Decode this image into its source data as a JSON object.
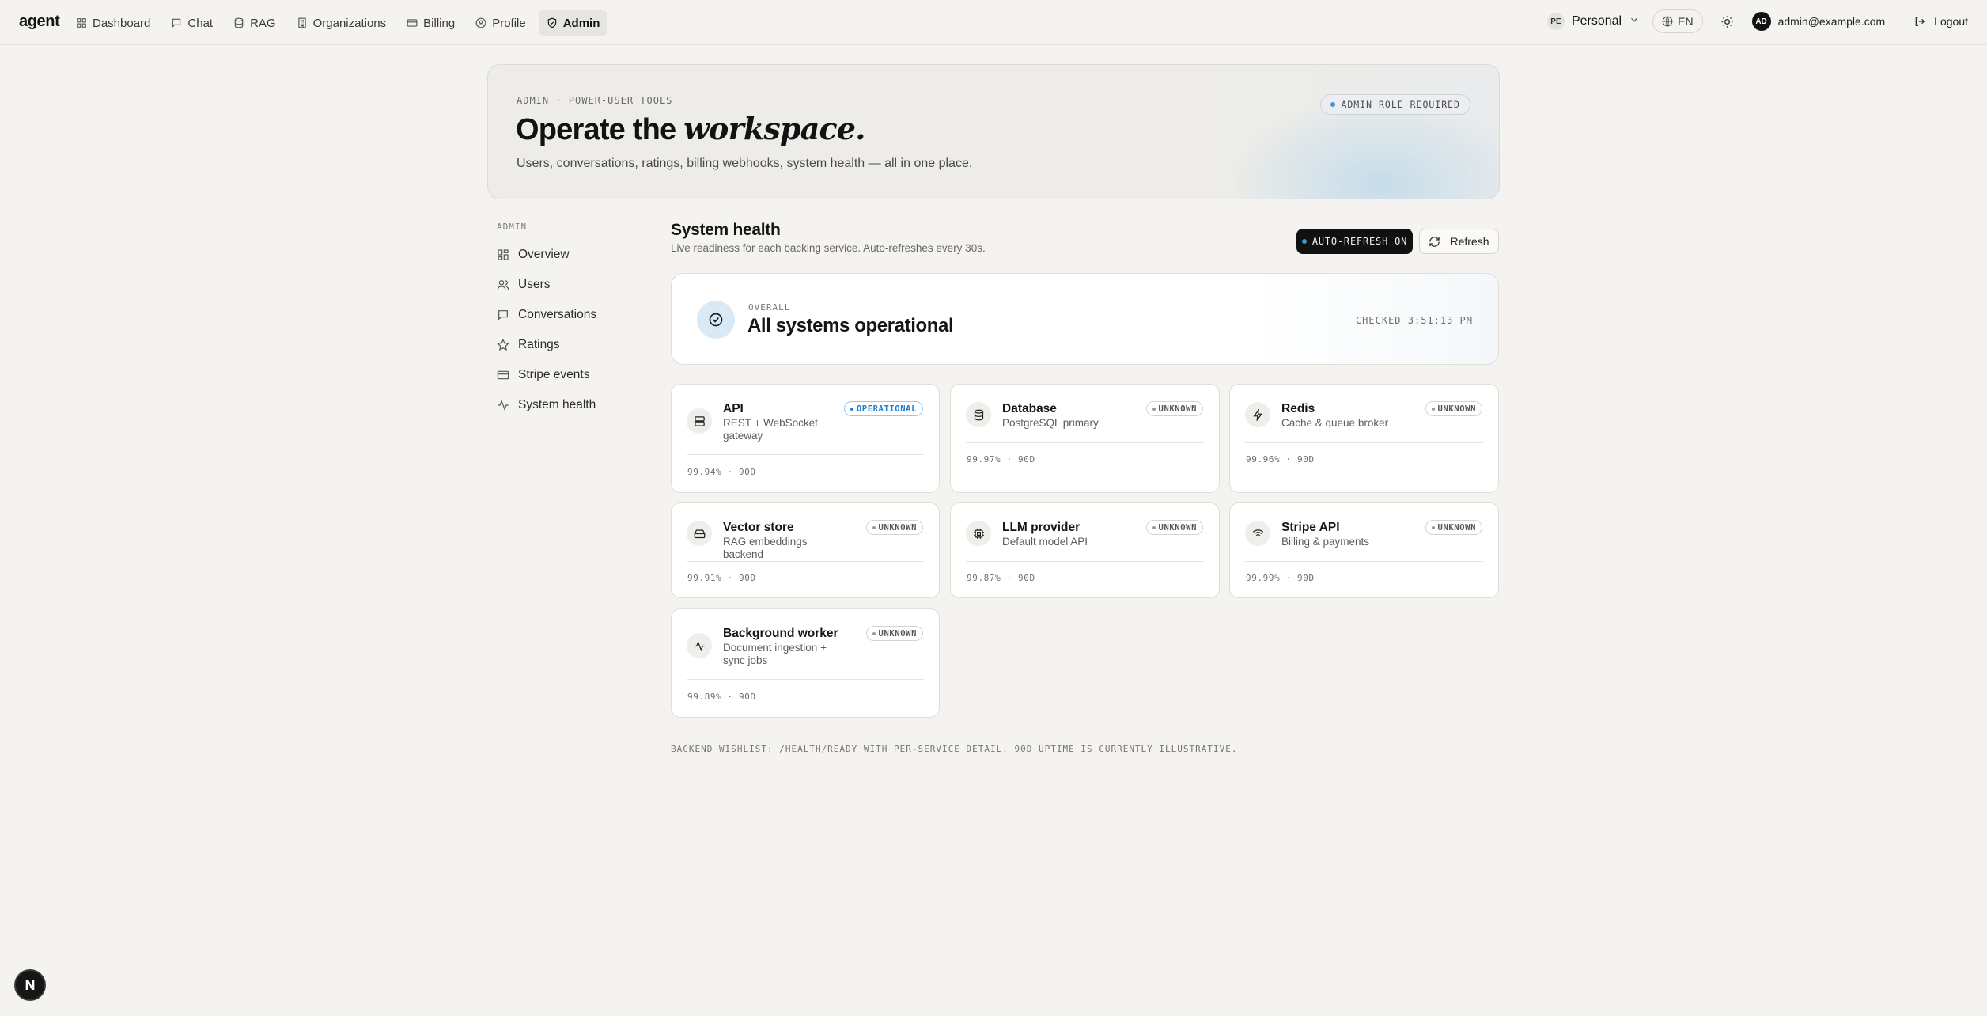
{
  "nav": {
    "brand": "agent",
    "items": [
      {
        "label": "Dashboard",
        "icon": "dashboard-icon"
      },
      {
        "label": "Chat",
        "icon": "chat-icon"
      },
      {
        "label": "RAG",
        "icon": "database-icon"
      },
      {
        "label": "Organizations",
        "icon": "building-icon"
      },
      {
        "label": "Billing",
        "icon": "credit-card-icon"
      },
      {
        "label": "Profile",
        "icon": "user-circle-icon"
      },
      {
        "label": "Admin",
        "icon": "shield-icon",
        "active": true
      }
    ],
    "workspace": {
      "initials": "PE",
      "name": "Personal"
    },
    "language": "EN",
    "user": {
      "initials": "AD",
      "email": "admin@example.com"
    },
    "logout_label": "Logout"
  },
  "hero": {
    "eyebrow": "ADMIN · POWER-USER TOOLS",
    "title_plain": "Operate the ",
    "title_emphasis": "workspace.",
    "subtitle": "Users, conversations, ratings, billing webhooks, system health — all in one place.",
    "badge": "ADMIN ROLE REQUIRED"
  },
  "sidebar": {
    "title": "ADMIN",
    "items": [
      {
        "label": "Overview",
        "icon": "grid-icon"
      },
      {
        "label": "Users",
        "icon": "users-icon"
      },
      {
        "label": "Conversations",
        "icon": "message-icon"
      },
      {
        "label": "Ratings",
        "icon": "star-icon"
      },
      {
        "label": "Stripe events",
        "icon": "credit-card-icon"
      },
      {
        "label": "System health",
        "icon": "activity-icon"
      }
    ]
  },
  "main": {
    "title": "System health",
    "subtitle": "Live readiness for each backing service. Auto-refreshes every 30s.",
    "auto_refresh_label": "AUTO-REFRESH ON",
    "refresh_label": "Refresh",
    "overall": {
      "label": "OVERALL",
      "status": "All systems operational",
      "checked": "CHECKED 3:51:13 PM"
    },
    "services": [
      {
        "name": "API",
        "desc": "REST + WebSocket gateway",
        "status": "OPERATIONAL",
        "uptime": "99.94% · 90D",
        "icon": "server-icon"
      },
      {
        "name": "Database",
        "desc": "PostgreSQL primary",
        "status": "UNKNOWN",
        "uptime": "99.97% · 90D",
        "icon": "database-icon"
      },
      {
        "name": "Redis",
        "desc": "Cache & queue broker",
        "status": "UNKNOWN",
        "uptime": "99.96% · 90D",
        "icon": "bolt-icon"
      },
      {
        "name": "Vector store",
        "desc": "RAG embeddings backend",
        "status": "UNKNOWN",
        "uptime": "99.91% · 90D",
        "icon": "hard-drive-icon"
      },
      {
        "name": "LLM provider",
        "desc": "Default model API",
        "status": "UNKNOWN",
        "uptime": "99.87% · 90D",
        "icon": "cpu-icon"
      },
      {
        "name": "Stripe API",
        "desc": "Billing & payments",
        "status": "UNKNOWN",
        "uptime": "99.99% · 90D",
        "icon": "wifi-icon"
      },
      {
        "name": "Background worker",
        "desc": "Document ingestion + sync jobs",
        "status": "UNKNOWN",
        "uptime": "99.89% · 90D",
        "icon": "activity-icon"
      }
    ],
    "footer_note": "BACKEND WISHLIST: /HEALTH/READY WITH PER-SERVICE DETAIL. 90D UPTIME IS CURRENTLY ILLUSTRATIVE."
  },
  "colors": {
    "background": "#f4f3ef",
    "accent": "#1d7fd1",
    "operational_badge": "#1d7fd1",
    "primary_button": "#111111"
  },
  "dev_badge": "N"
}
